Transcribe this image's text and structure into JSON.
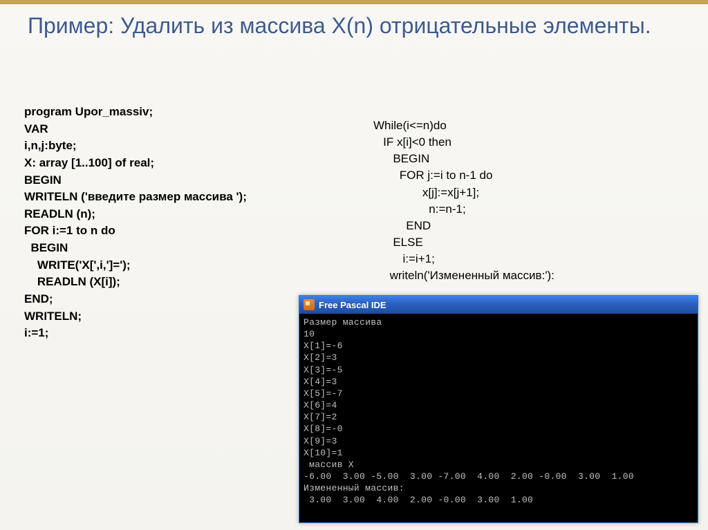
{
  "title": "Пример: Удалить из массива X(n) отрицательные элементы.",
  "code_left": "program Upor_massiv;\nVAR\ni,n,j:byte;\nX: array [1..100] of real;\nBEGIN\nWRITELN ('введите размер массива ');\nREADLN (n);\nFOR i:=1 to n do\n  BEGIN\n    WRITE('X[',i,']=');\n    READLN (X[i]);\nEND;\nWRITELN;\ni:=1;",
  "code_right": "While(i<=n)do\n   IF x[i]<0 then\n      BEGIN\n        FOR j:=i to n-1 do\n               x[j]:=x[j+1];\n                 n:=n-1;\n          END\n      ELSE\n         i:=i+1;\n     writeln('Измененный массив:'):",
  "ide": {
    "title": "Free Pascal IDE",
    "output": "Размер массива\n10\nX[1]=-6\nX[2]=3\nX[3]=-5\nX[4]=3\nX[5]=-7\nX[6]=4\nX[7]=2\nX[8]=-0\nX[9]=3\nX[10]=1\n массив X\n-6.00  3.00 -5.00  3.00 -7.00  4.00  2.00 -0.00  3.00  1.00\nИзмененный массив:\n 3.00  3.00  4.00  2.00 -0.00  3.00  1.00"
  }
}
